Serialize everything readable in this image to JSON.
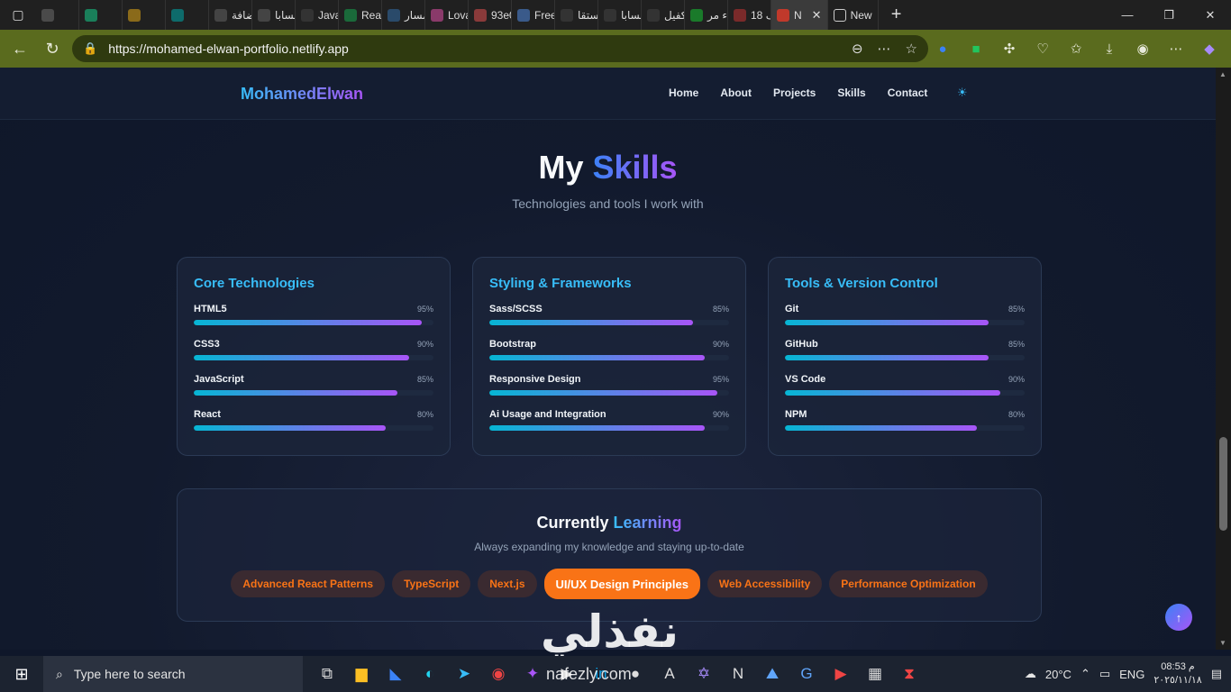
{
  "browser": {
    "tabs": [
      {
        "label": "",
        "color": "#4a4a4a"
      },
      {
        "label": "",
        "color": "#1a7f5a"
      },
      {
        "label": "",
        "color": "#8a6a1a"
      },
      {
        "label": "",
        "color": "#0e6b6b"
      },
      {
        "label": "إضافة",
        "color": "#444"
      },
      {
        "label": "حسابا",
        "color": "#444"
      },
      {
        "label": "JavaS",
        "color": "#333"
      },
      {
        "label": "React",
        "color": "#1a6a3a"
      },
      {
        "label": "مسار",
        "color": "#2a4a6a"
      },
      {
        "label": "Lovab",
        "color": "#8a3a6a"
      },
      {
        "label": "93e0",
        "color": "#8a3a3a"
      },
      {
        "label": "Freep",
        "color": "#3a5a8a"
      },
      {
        "label": "مستقا",
        "color": "#333"
      },
      {
        "label": "حسابا",
        "color": "#333"
      },
      {
        "label": "كفيل -",
        "color": "#333"
      },
      {
        "label": "بناء مر",
        "color": "#1a7a2a"
      },
      {
        "label": "18 أف",
        "color": "#7a2a2a"
      }
    ],
    "active_tab": {
      "label": "N",
      "close": "✕"
    },
    "new_tab": {
      "label": "New"
    },
    "new_tab_plus": "+",
    "url": "https://mohamed-elwan-portfolio.netlify.app",
    "window_controls": {
      "minimize": "—",
      "maximize": "❐",
      "close": "✕"
    }
  },
  "site": {
    "logo": "MohamedElwan",
    "nav": [
      "Home",
      "About",
      "Projects",
      "Skills",
      "Contact"
    ],
    "theme_icon": "☀"
  },
  "skills_section": {
    "title_plain": "My",
    "title_accent": "Skills",
    "subtitle": "Technologies and tools I work with",
    "categories": [
      {
        "title": "Core Technologies",
        "skills": [
          {
            "name": "HTML5",
            "percent": 95,
            "label": "95%"
          },
          {
            "name": "CSS3",
            "percent": 90,
            "label": "90%"
          },
          {
            "name": "JavaScript",
            "percent": 85,
            "label": "85%"
          },
          {
            "name": "React",
            "percent": 80,
            "label": "80%"
          }
        ]
      },
      {
        "title": "Styling & Frameworks",
        "skills": [
          {
            "name": "Sass/SCSS",
            "percent": 85,
            "label": "85%"
          },
          {
            "name": "Bootstrap",
            "percent": 90,
            "label": "90%"
          },
          {
            "name": "Responsive Design",
            "percent": 95,
            "label": "95%"
          },
          {
            "name": "Ai Usage and Integration",
            "percent": 90,
            "label": "90%"
          }
        ]
      },
      {
        "title": "Tools & Version Control",
        "skills": [
          {
            "name": "Git",
            "percent": 85,
            "label": "85%"
          },
          {
            "name": "GitHub",
            "percent": 85,
            "label": "85%"
          },
          {
            "name": "VS Code",
            "percent": 90,
            "label": "90%"
          },
          {
            "name": "NPM",
            "percent": 80,
            "label": "80%"
          }
        ]
      }
    ]
  },
  "learning": {
    "title_plain": "Currently",
    "title_accent": "Learning",
    "subtitle": "Always expanding my knowledge and staying up-to-date",
    "chips": [
      {
        "label": "Advanced React Patterns",
        "highlighted": false
      },
      {
        "label": "TypeScript",
        "highlighted": false
      },
      {
        "label": "Next.js",
        "highlighted": false
      },
      {
        "label": "UI/UX Design Principles",
        "highlighted": true
      },
      {
        "label": "Web Accessibility",
        "highlighted": false
      },
      {
        "label": "Performance Optimization",
        "highlighted": false
      }
    ]
  },
  "back_to_top_icon": "↑",
  "taskbar": {
    "search_placeholder": "Type here to search",
    "weather": "20°C",
    "language": "ENG",
    "time": "08:53 م",
    "date": "٢٠٢٥/١١/١٨"
  },
  "watermark": {
    "arabic": "نفذلي",
    "latin": "nafezly.com"
  },
  "colors": {
    "accent_blue": "#38bdf8",
    "accent_purple": "#a855f7",
    "accent_orange": "#f97316",
    "page_bg": "#0f172a",
    "address_bar": "#5a6b1e"
  }
}
